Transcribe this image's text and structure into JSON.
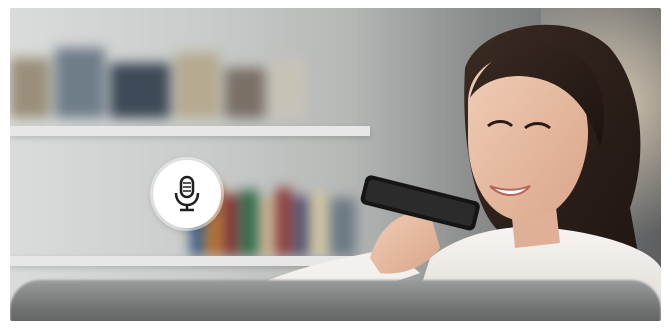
{
  "scene": {
    "subject": "woman-speaking-into-phone",
    "icon": "microphone-icon",
    "colors": {
      "waveform_left": "#3b6fd8",
      "waveform_mid": "#2ec0b6",
      "waveform_green": "#7ed04b",
      "waveform_right": "#d94bd1",
      "mic_badge_bg": "#ffffff",
      "mic_icon": "#1f1f1f"
    }
  }
}
